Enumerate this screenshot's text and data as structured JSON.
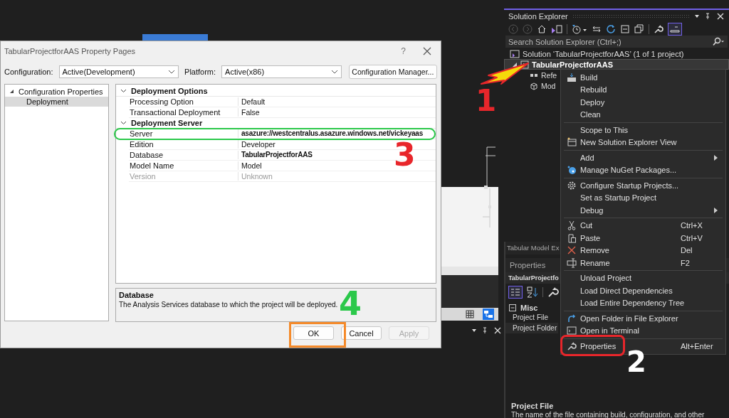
{
  "dialog": {
    "title": "TabularProjectforAAS Property Pages",
    "help": "?",
    "configuration_label": "Configuration:",
    "configuration_value": "Active(Development)",
    "platform_label": "Platform:",
    "platform_value": "Active(x86)",
    "configuration_manager_button": "Configuration Manager...",
    "tree": [
      {
        "label": "Configuration Properties",
        "expanded": true,
        "selected": false,
        "children": [
          {
            "label": "Deployment",
            "selected": true
          }
        ]
      }
    ],
    "property_groups": [
      {
        "name": "Deployment Options",
        "expanded": true,
        "properties": [
          {
            "name": "Processing Option",
            "value": "Default",
            "modified": false,
            "disabled": false
          },
          {
            "name": "Transactional Deployment",
            "value": "False",
            "modified": false,
            "disabled": false
          }
        ]
      },
      {
        "name": "Deployment Server",
        "expanded": true,
        "properties": [
          {
            "name": "Server",
            "value": "asazure://westcentralus.asazure.windows.net/vickeyaas",
            "modified": true,
            "disabled": false
          },
          {
            "name": "Edition",
            "value": "Developer",
            "modified": false,
            "disabled": false
          },
          {
            "name": "Database",
            "value": "TabularProjectforAAS",
            "modified": true,
            "disabled": false
          },
          {
            "name": "Model Name",
            "value": "Model",
            "modified": false,
            "disabled": false
          },
          {
            "name": "Version",
            "value": "Unknown",
            "modified": false,
            "disabled": true
          }
        ]
      }
    ],
    "description": {
      "title": "Database",
      "text": "The Analysis Services database to which the project will be deployed."
    },
    "buttons": [
      {
        "label": "OK",
        "disabled": false
      },
      {
        "label": "Cancel",
        "disabled": false
      },
      {
        "label": "Apply",
        "disabled": true
      }
    ]
  },
  "solution_explorer": {
    "title": "Solution Explorer",
    "search": {
      "placeholder": "Search Solution Explorer (Ctrl+;)"
    },
    "tree": [
      {
        "label": "Solution ‘TabularProjectforAAS’ (1 of 1 project)",
        "selected": false,
        "children": [
          {
            "label": "TabularProjectforAAS",
            "selected": true,
            "expanded": true,
            "children": [
              {
                "label": "Refe",
                "selected": false
              },
              {
                "label": "Mod",
                "selected": false
              }
            ]
          }
        ]
      }
    ]
  },
  "context_menu": {
    "groups": [
      [
        {
          "label": "Build"
        },
        {
          "label": "Rebuild"
        },
        {
          "label": "Deploy"
        },
        {
          "label": "Clean"
        }
      ],
      [
        {
          "label": "Scope to This"
        },
        {
          "label": "New Solution Explorer View"
        }
      ],
      [
        {
          "label": "Add",
          "submenu": true
        },
        {
          "label": "Manage NuGet Packages..."
        }
      ],
      [
        {
          "label": "Configure Startup Projects..."
        },
        {
          "label": "Set as Startup Project"
        },
        {
          "label": "Debug",
          "submenu": true
        }
      ],
      [
        {
          "label": "Cut",
          "shortcut": "Ctrl+X"
        },
        {
          "label": "Paste",
          "shortcut": "Ctrl+V"
        },
        {
          "label": "Remove",
          "shortcut": "Del"
        },
        {
          "label": "Rename",
          "shortcut": "F2"
        }
      ],
      [
        {
          "label": "Unload Project"
        },
        {
          "label": "Load Direct Dependencies"
        },
        {
          "label": "Load Entire Dependency Tree"
        }
      ],
      [
        {
          "label": "Open Folder in File Explorer"
        },
        {
          "label": "Open in Terminal"
        }
      ],
      [
        {
          "label": "Properties",
          "shortcut": "Alt+Enter"
        }
      ]
    ]
  },
  "model_explorer_tab": "Tabular Model Ex",
  "properties_panel": {
    "title": "Properties",
    "object": "TabularProjectfo",
    "category": {
      "name": "Misc",
      "expanded": true,
      "items": [
        {
          "name": "Project File",
          "selected": false
        },
        {
          "name": "Project Folder",
          "selected": true
        }
      ]
    },
    "description": {
      "title": "Project File",
      "text": "The name of the file containing build, configuration, and other"
    }
  },
  "annotations": [
    {
      "label": "1",
      "color": "#e8262b"
    },
    {
      "label": "2",
      "color": "#ffffff"
    },
    {
      "label": "3",
      "color": "#e8262b"
    },
    {
      "label": "4",
      "color": "#2bc84a"
    }
  ]
}
